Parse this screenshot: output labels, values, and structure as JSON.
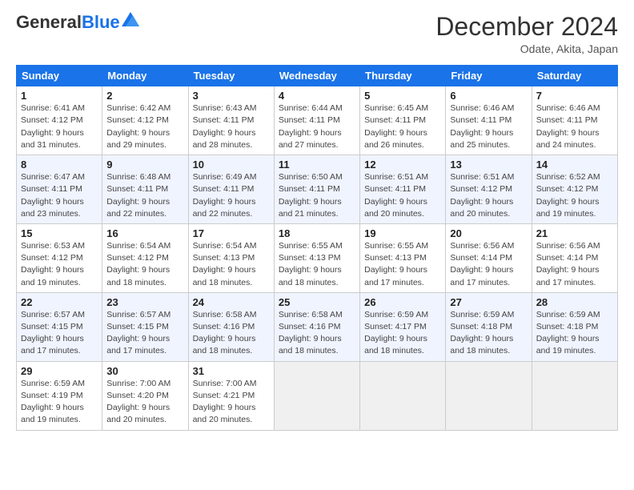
{
  "header": {
    "logo_general": "General",
    "logo_blue": "Blue",
    "month_title": "December 2024",
    "subtitle": "Odate, Akita, Japan"
  },
  "weekdays": [
    "Sunday",
    "Monday",
    "Tuesday",
    "Wednesday",
    "Thursday",
    "Friday",
    "Saturday"
  ],
  "weeks": [
    [
      {
        "day": "1",
        "sunrise": "Sunrise: 6:41 AM",
        "sunset": "Sunset: 4:12 PM",
        "daylight": "Daylight: 9 hours and 31 minutes."
      },
      {
        "day": "2",
        "sunrise": "Sunrise: 6:42 AM",
        "sunset": "Sunset: 4:12 PM",
        "daylight": "Daylight: 9 hours and 29 minutes."
      },
      {
        "day": "3",
        "sunrise": "Sunrise: 6:43 AM",
        "sunset": "Sunset: 4:11 PM",
        "daylight": "Daylight: 9 hours and 28 minutes."
      },
      {
        "day": "4",
        "sunrise": "Sunrise: 6:44 AM",
        "sunset": "Sunset: 4:11 PM",
        "daylight": "Daylight: 9 hours and 27 minutes."
      },
      {
        "day": "5",
        "sunrise": "Sunrise: 6:45 AM",
        "sunset": "Sunset: 4:11 PM",
        "daylight": "Daylight: 9 hours and 26 minutes."
      },
      {
        "day": "6",
        "sunrise": "Sunrise: 6:46 AM",
        "sunset": "Sunset: 4:11 PM",
        "daylight": "Daylight: 9 hours and 25 minutes."
      },
      {
        "day": "7",
        "sunrise": "Sunrise: 6:46 AM",
        "sunset": "Sunset: 4:11 PM",
        "daylight": "Daylight: 9 hours and 24 minutes."
      }
    ],
    [
      {
        "day": "8",
        "sunrise": "Sunrise: 6:47 AM",
        "sunset": "Sunset: 4:11 PM",
        "daylight": "Daylight: 9 hours and 23 minutes."
      },
      {
        "day": "9",
        "sunrise": "Sunrise: 6:48 AM",
        "sunset": "Sunset: 4:11 PM",
        "daylight": "Daylight: 9 hours and 22 minutes."
      },
      {
        "day": "10",
        "sunrise": "Sunrise: 6:49 AM",
        "sunset": "Sunset: 4:11 PM",
        "daylight": "Daylight: 9 hours and 22 minutes."
      },
      {
        "day": "11",
        "sunrise": "Sunrise: 6:50 AM",
        "sunset": "Sunset: 4:11 PM",
        "daylight": "Daylight: 9 hours and 21 minutes."
      },
      {
        "day": "12",
        "sunrise": "Sunrise: 6:51 AM",
        "sunset": "Sunset: 4:11 PM",
        "daylight": "Daylight: 9 hours and 20 minutes."
      },
      {
        "day": "13",
        "sunrise": "Sunrise: 6:51 AM",
        "sunset": "Sunset: 4:12 PM",
        "daylight": "Daylight: 9 hours and 20 minutes."
      },
      {
        "day": "14",
        "sunrise": "Sunrise: 6:52 AM",
        "sunset": "Sunset: 4:12 PM",
        "daylight": "Daylight: 9 hours and 19 minutes."
      }
    ],
    [
      {
        "day": "15",
        "sunrise": "Sunrise: 6:53 AM",
        "sunset": "Sunset: 4:12 PM",
        "daylight": "Daylight: 9 hours and 19 minutes."
      },
      {
        "day": "16",
        "sunrise": "Sunrise: 6:54 AM",
        "sunset": "Sunset: 4:12 PM",
        "daylight": "Daylight: 9 hours and 18 minutes."
      },
      {
        "day": "17",
        "sunrise": "Sunrise: 6:54 AM",
        "sunset": "Sunset: 4:13 PM",
        "daylight": "Daylight: 9 hours and 18 minutes."
      },
      {
        "day": "18",
        "sunrise": "Sunrise: 6:55 AM",
        "sunset": "Sunset: 4:13 PM",
        "daylight": "Daylight: 9 hours and 18 minutes."
      },
      {
        "day": "19",
        "sunrise": "Sunrise: 6:55 AM",
        "sunset": "Sunset: 4:13 PM",
        "daylight": "Daylight: 9 hours and 17 minutes."
      },
      {
        "day": "20",
        "sunrise": "Sunrise: 6:56 AM",
        "sunset": "Sunset: 4:14 PM",
        "daylight": "Daylight: 9 hours and 17 minutes."
      },
      {
        "day": "21",
        "sunrise": "Sunrise: 6:56 AM",
        "sunset": "Sunset: 4:14 PM",
        "daylight": "Daylight: 9 hours and 17 minutes."
      }
    ],
    [
      {
        "day": "22",
        "sunrise": "Sunrise: 6:57 AM",
        "sunset": "Sunset: 4:15 PM",
        "daylight": "Daylight: 9 hours and 17 minutes."
      },
      {
        "day": "23",
        "sunrise": "Sunrise: 6:57 AM",
        "sunset": "Sunset: 4:15 PM",
        "daylight": "Daylight: 9 hours and 17 minutes."
      },
      {
        "day": "24",
        "sunrise": "Sunrise: 6:58 AM",
        "sunset": "Sunset: 4:16 PM",
        "daylight": "Daylight: 9 hours and 18 minutes."
      },
      {
        "day": "25",
        "sunrise": "Sunrise: 6:58 AM",
        "sunset": "Sunset: 4:16 PM",
        "daylight": "Daylight: 9 hours and 18 minutes."
      },
      {
        "day": "26",
        "sunrise": "Sunrise: 6:59 AM",
        "sunset": "Sunset: 4:17 PM",
        "daylight": "Daylight: 9 hours and 18 minutes."
      },
      {
        "day": "27",
        "sunrise": "Sunrise: 6:59 AM",
        "sunset": "Sunset: 4:18 PM",
        "daylight": "Daylight: 9 hours and 18 minutes."
      },
      {
        "day": "28",
        "sunrise": "Sunrise: 6:59 AM",
        "sunset": "Sunset: 4:18 PM",
        "daylight": "Daylight: 9 hours and 19 minutes."
      }
    ],
    [
      {
        "day": "29",
        "sunrise": "Sunrise: 6:59 AM",
        "sunset": "Sunset: 4:19 PM",
        "daylight": "Daylight: 9 hours and 19 minutes."
      },
      {
        "day": "30",
        "sunrise": "Sunrise: 7:00 AM",
        "sunset": "Sunset: 4:20 PM",
        "daylight": "Daylight: 9 hours and 20 minutes."
      },
      {
        "day": "31",
        "sunrise": "Sunrise: 7:00 AM",
        "sunset": "Sunset: 4:21 PM",
        "daylight": "Daylight: 9 hours and 20 minutes."
      },
      null,
      null,
      null,
      null
    ]
  ]
}
